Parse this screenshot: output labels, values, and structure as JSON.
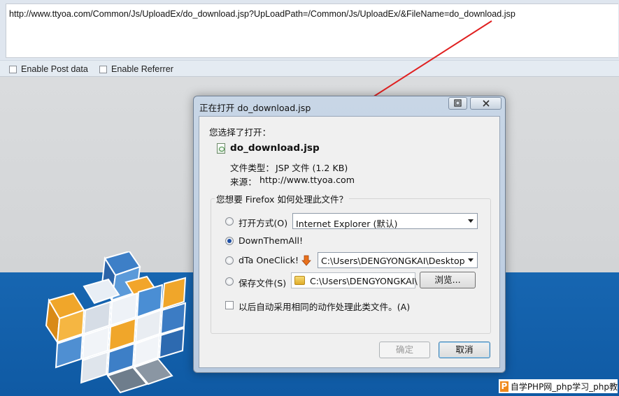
{
  "hackbar": {
    "url": "http://www.ttyoa.com/Common/Js/UploadEx/do_download.jsp?UpLoadPath=/Common/Js/UploadEx/&FileName=do_download.jsp",
    "enable_post_label": "Enable Post data",
    "enable_referrer_label": "Enable Referrer"
  },
  "dialog": {
    "title": "正在打开 do_download.jsp",
    "chose_label": "您选择了打开：",
    "filename": "do_download.jsp",
    "file_type_label": "文件类型：",
    "file_type_value": "JSP 文件 (1.2 KB)",
    "source_label": "来源：",
    "source_value": "http://www.ttyoa.com",
    "question": "您想要 Firefox 如何处理此文件？",
    "options": {
      "open_with_label": "打开方式(O)",
      "open_with_app": "Internet Explorer (默认)",
      "downthemall_label": "DownThemAll!",
      "dta_oneclick_label": "dTa OneClick!",
      "dta_path": "C:\\Users\\DENGYONGKAI\\Desktop\\",
      "save_file_label": "保存文件(S)",
      "save_path": "C:\\Users\\DENGYONGKAI\\",
      "browse_label": "浏览...",
      "selected": "downthemall"
    },
    "auto_label": "以后自动采用相同的动作处理此类文件。(A)",
    "ok_label": "确定",
    "cancel_label": "取消"
  },
  "watermark": {
    "logo_letter": "P",
    "text": "自学PHP网_php学习_php教"
  },
  "colors": {
    "annotation_arrow": "#e02020",
    "page_blue": "#1766b1",
    "dialog_frame": "#c8d6e6"
  }
}
